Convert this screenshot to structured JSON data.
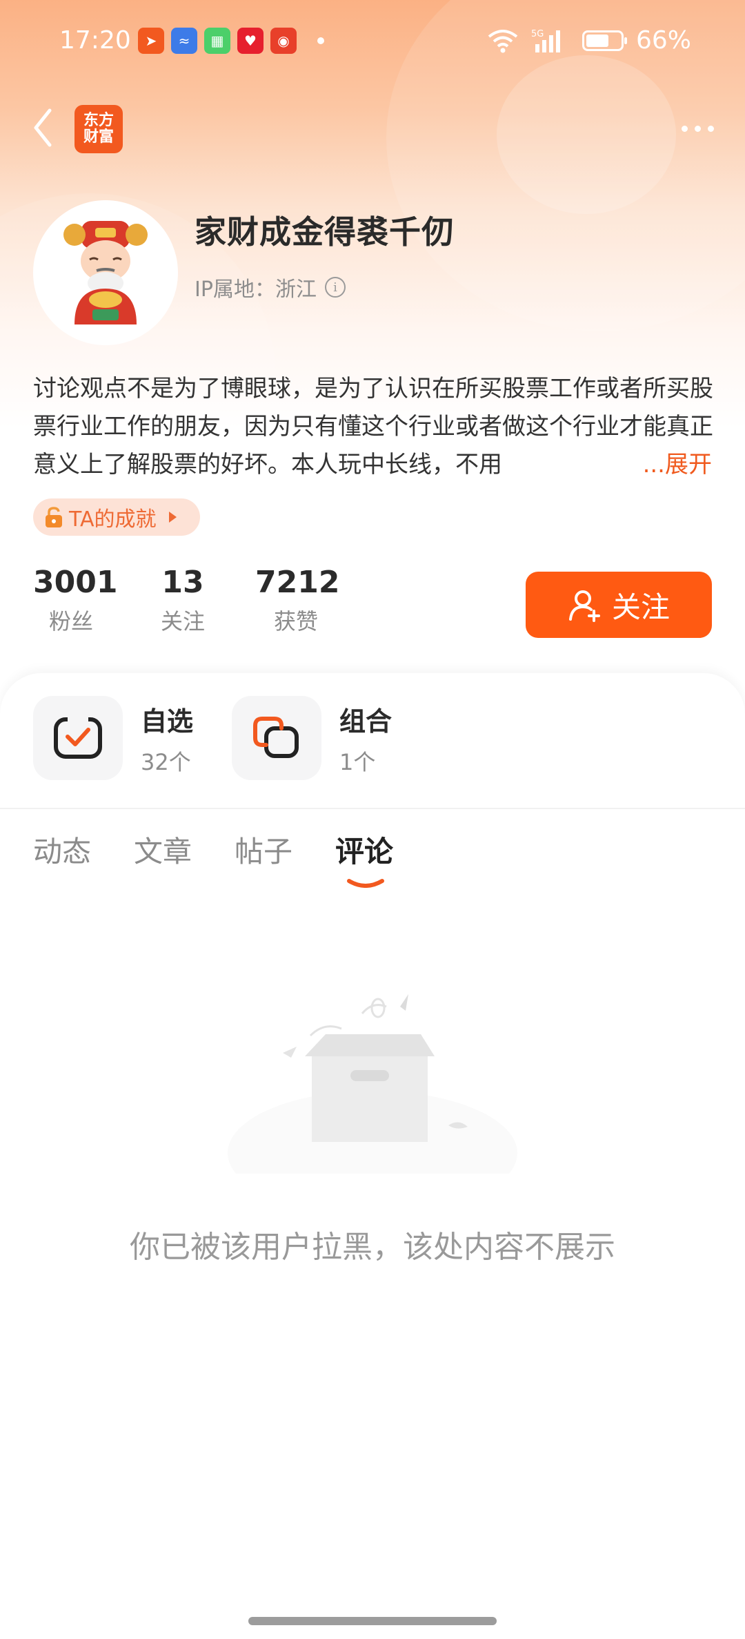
{
  "status_bar": {
    "time": "17:20",
    "network": "5G",
    "battery": "66%",
    "battery_level": 0.66,
    "app_icons": [
      "paper-plane-icon",
      "chart-icon",
      "grid-icon",
      "heart-badge-icon",
      "bag-icon"
    ]
  },
  "header": {
    "logo_line1": "东方",
    "logo_line2": "财富"
  },
  "profile": {
    "username": "家财成金得裘千仞",
    "ip_location": "IP属地：浙江",
    "bio": "讨论观点不是为了博眼球，是为了认识在所买股票工作或者所买股票行业工作的朋友，因为只有懂这个行业或者做这个行业才能真正意义上了解股票的好坏。本人玩中长线，不用",
    "bio_expand": "...展开",
    "achievement": "TA的成就"
  },
  "stats": [
    {
      "value": "3001",
      "label": "粉丝"
    },
    {
      "value": "13",
      "label": "关注"
    },
    {
      "value": "7212",
      "label": "获赞"
    }
  ],
  "follow_button": "关注",
  "quick_links": [
    {
      "title": "自选",
      "sub": "32个"
    },
    {
      "title": "组合",
      "sub": "1个"
    }
  ],
  "tabs": [
    "动态",
    "文章",
    "帖子",
    "评论"
  ],
  "active_tab": "评论",
  "empty_message": "你已被该用户拉黑，该处内容不展示",
  "colors": {
    "accent": "#ff5a12",
    "header_gradient_top": "#fbb184"
  }
}
